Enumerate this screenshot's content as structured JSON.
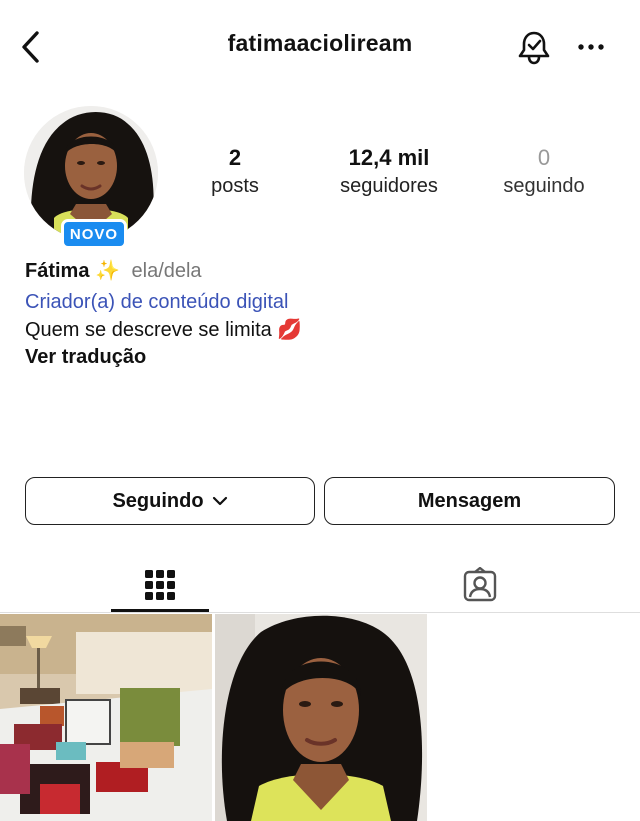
{
  "header": {
    "username": "fatimaacioliream",
    "back_icon": "chevron-left-icon",
    "bell_icon": "bell-icon",
    "more_icon": "more-horizontal-icon"
  },
  "profile": {
    "badge": "NOVO",
    "stats": [
      {
        "value": "2",
        "label": "posts"
      },
      {
        "value": "12,4 mil",
        "label": "seguidores"
      },
      {
        "value": "0",
        "label": "seguindo"
      }
    ],
    "name": "Fátima",
    "name_emoji": "✨",
    "pronouns": "ela/dela",
    "category": "Criador(a) de conteúdo digital",
    "bio": "Quem se descreve se limita",
    "bio_emoji": "💋",
    "translate": "Ver tradução"
  },
  "actions": {
    "following": "Seguindo",
    "message": "Mensagem"
  },
  "tabs": {
    "grid_icon": "grid-icon",
    "tagged_icon": "tagged-person-icon",
    "selected": "grid"
  },
  "colors": {
    "badge": "#1a8cf0",
    "category_link": "#3b53b7"
  }
}
